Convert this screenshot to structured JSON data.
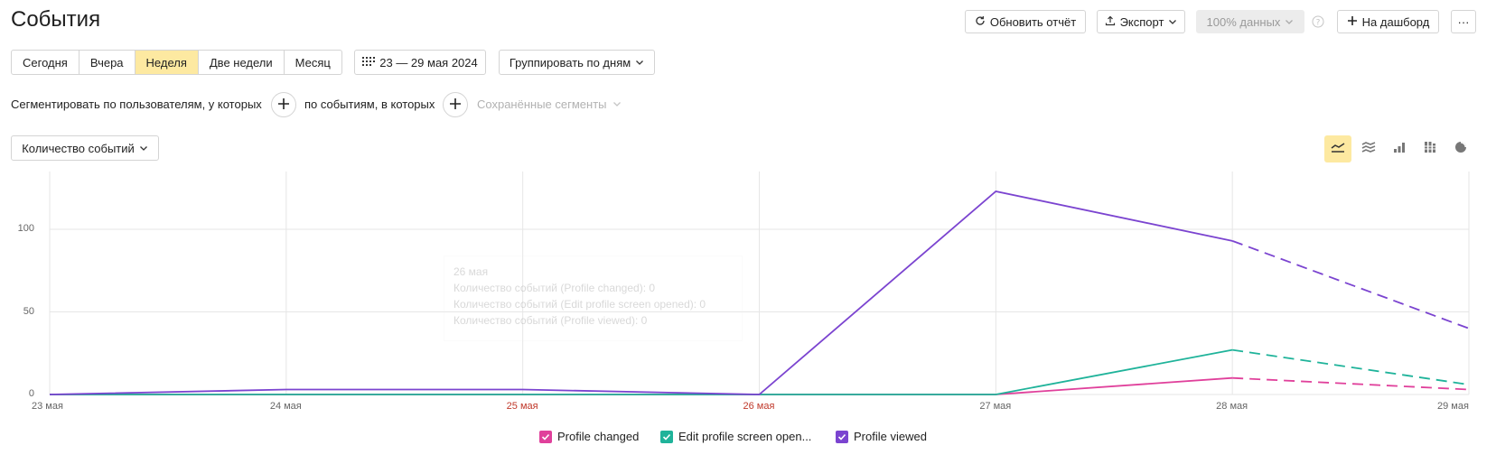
{
  "header": {
    "title": "События",
    "refresh_label": "Обновить отчёт",
    "export_label": "Экспорт",
    "data_label": "100% данных",
    "dashboard_label": "На дашборд",
    "more_label": "···"
  },
  "period": {
    "options": [
      "Сегодня",
      "Вчера",
      "Неделя",
      "Две недели",
      "Месяц"
    ],
    "active": "Неделя",
    "date_range": "23 — 29 мая 2024",
    "group_by": "Группировать по дням"
  },
  "segmentation": {
    "users_label": "Сегментировать по пользователям, у которых",
    "events_label": "по событиям, в которых",
    "saved_label": "Сохранённые сегменты"
  },
  "metric": {
    "label": "Количество событий"
  },
  "view_modes": [
    {
      "icon": "line-chart-icon",
      "active": true
    },
    {
      "icon": "stacked-area-icon",
      "active": false
    },
    {
      "icon": "bar-chart-icon",
      "active": false
    },
    {
      "icon": "stacked-bar-icon",
      "active": false
    },
    {
      "icon": "pie-chart-icon",
      "active": false
    }
  ],
  "tooltip": {
    "date": "26 мая",
    "lines": [
      "Количество событий (Profile changed): 0",
      "Количество событий (Edit profile screen opened): 0",
      "Количество событий (Profile viewed): 0"
    ]
  },
  "legend": [
    {
      "label": "Profile changed",
      "color": "#e0409b"
    },
    {
      "label": "Edit profile screen open...",
      "color": "#1fb39a"
    },
    {
      "label": "Profile viewed",
      "color": "#7b44d0"
    }
  ],
  "chart_data": {
    "type": "line",
    "categories": [
      "23 мая",
      "24 мая",
      "25 мая",
      "26 мая",
      "27 мая",
      "28 мая",
      "29 мая"
    ],
    "weekend_categories": [
      "25 мая",
      "26 мая"
    ],
    "ylim": [
      0,
      135
    ],
    "yticks": [
      0,
      50,
      100
    ],
    "incomplete_from_index": 5,
    "grid": true,
    "series": [
      {
        "name": "Profile changed",
        "color": "#e0409b",
        "values": [
          0,
          0,
          0,
          0,
          0,
          10,
          3
        ]
      },
      {
        "name": "Edit profile screen opened",
        "color": "#1fb39a",
        "values": [
          0,
          0,
          0,
          0,
          0,
          27,
          6
        ]
      },
      {
        "name": "Profile viewed",
        "color": "#7b44d0",
        "values": [
          0,
          3,
          3,
          0,
          123,
          93,
          40
        ]
      }
    ]
  }
}
